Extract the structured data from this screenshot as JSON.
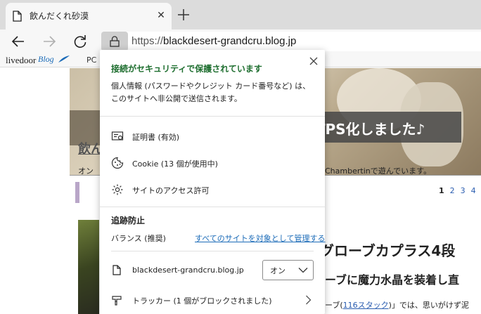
{
  "tab": {
    "title": "飲んだくれ砂漠",
    "close_glyph": "✕"
  },
  "address_bar": {
    "scheme": "https://",
    "host": "blackdesert-grandcru.blog.jp"
  },
  "bookmarks": {
    "livedoor": "livedoor",
    "blog": "Blog",
    "pc": "PC"
  },
  "page": {
    "banner": "HTTPS化しました♪",
    "title_fragment": "飲ん",
    "desc_left": "オン",
    "desc_right": "Chambertinで遊んでいます。",
    "pager": [
      "1",
      "2",
      "3",
      "4"
    ],
    "post_title": "グローブカプラス4段",
    "post_sub": "ーブに魔力水晶を装着し直",
    "post_text_prefix": "ーブ(",
    "post_link": "116スタック",
    "post_text_suffix": ")」では、思いがけず泥"
  },
  "security_flyout": {
    "heading": "接続がセキュリティで保護されています",
    "description": "個人情報 (パスワードやクレジット カード番号など) は、このサイトへ非公開で送信されます。",
    "certificate": "証明書 (有効)",
    "cookie": "Cookie (13 個が使用中)",
    "permissions": "サイトのアクセス許可",
    "tracking": {
      "heading": "追跡防止",
      "level": "バランス (推奨)",
      "manage_link": "すべてのサイトを対象として管理する",
      "site": "blackdesert-grandcru.blog.jp",
      "toggle_value": "オン",
      "trackers": "トラッカー (1 個がブロックされました)"
    }
  },
  "colors": {
    "secure_green": "#1e6e2f",
    "link_blue": "#1b6bb8"
  }
}
